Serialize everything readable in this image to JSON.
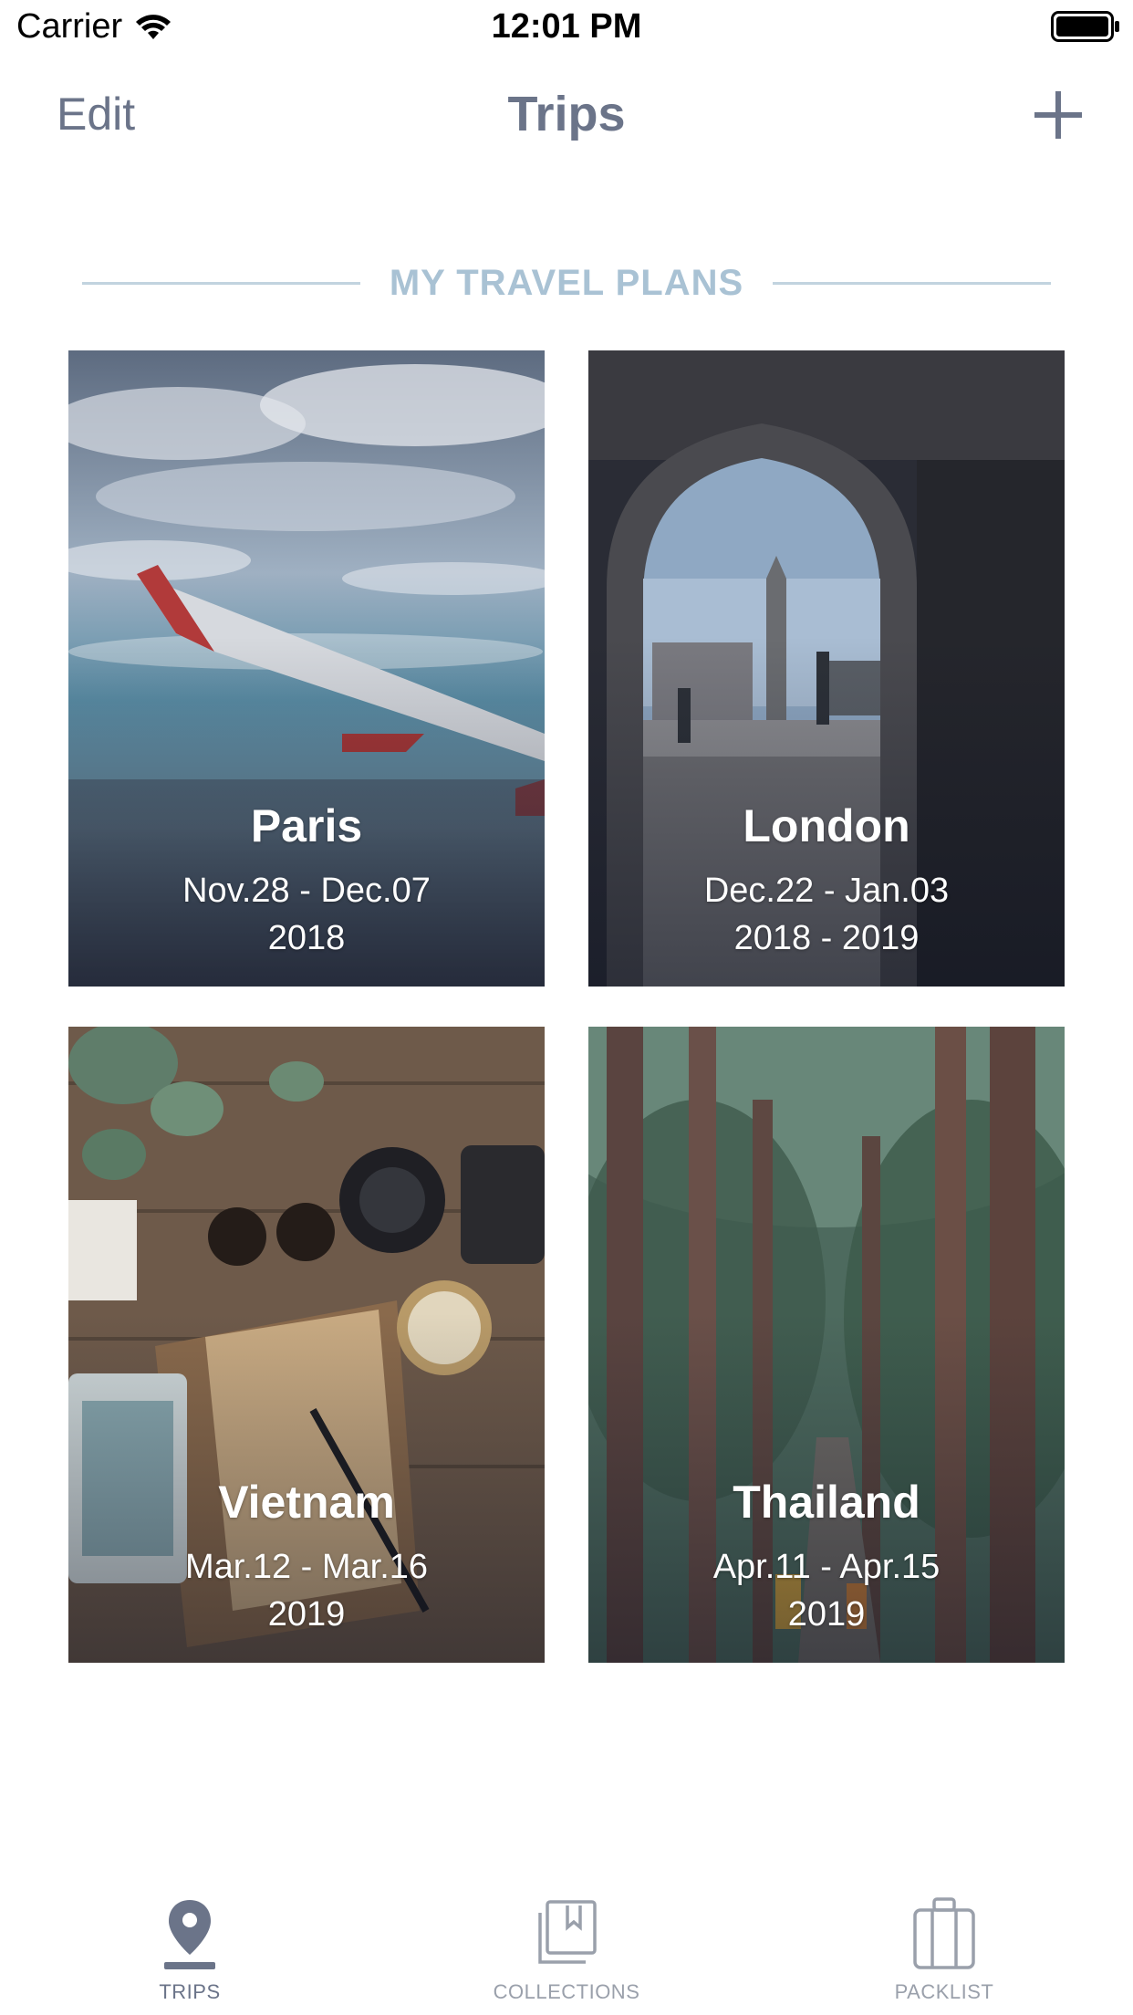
{
  "status_bar": {
    "carrier": "Carrier",
    "time": "12:01 PM",
    "icons": [
      "wifi-icon",
      "battery-icon"
    ]
  },
  "nav": {
    "edit_label": "Edit",
    "title": "Trips",
    "add_icon": "plus-icon"
  },
  "section": {
    "title": "MY TRAVEL PLANS"
  },
  "trips": [
    {
      "name": "Paris",
      "dates": "Nov.28 - Dec.07",
      "year": "2018"
    },
    {
      "name": "London",
      "dates": "Dec.22 - Jan.03",
      "year": "2018 - 2019"
    },
    {
      "name": "Vietnam",
      "dates": "Mar.12 - Mar.16",
      "year": "2019"
    },
    {
      "name": "Thailand",
      "dates": "Apr.11 - Apr.15",
      "year": "2019"
    }
  ],
  "tabs": [
    {
      "label": "TRIPS",
      "icon": "map-pin-icon",
      "selected": true
    },
    {
      "label": "COLLECTIONS",
      "icon": "collections-icon",
      "selected": false
    },
    {
      "label": "PACKLIST",
      "icon": "suitcase-icon",
      "selected": false
    }
  ],
  "colors": {
    "primary_text": "#6b7489",
    "section_accent": "#a9c2d4",
    "inactive_tab": "#9aa0ab"
  }
}
